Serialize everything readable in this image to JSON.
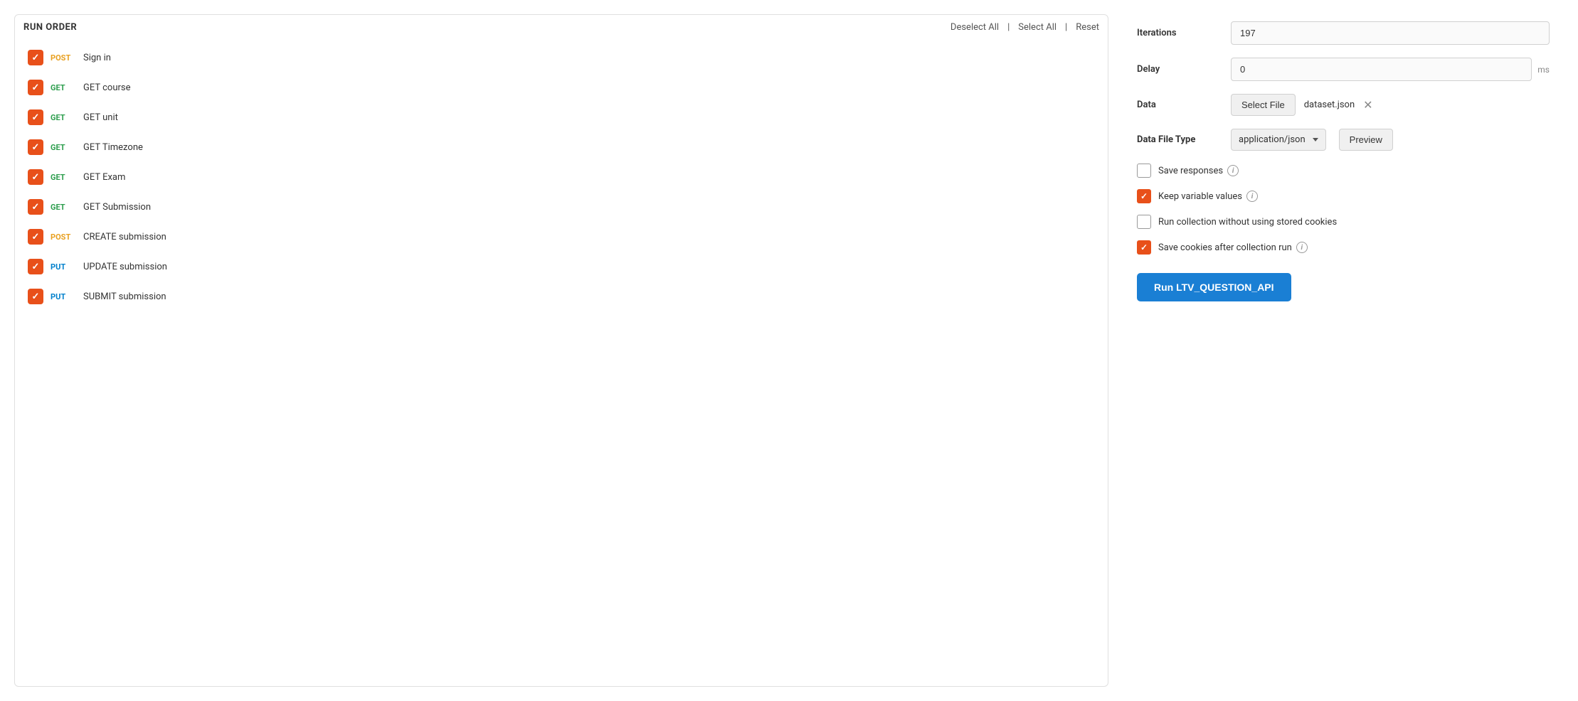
{
  "header": {
    "run_order_title": "RUN ORDER",
    "deselect_all": "Deselect All",
    "select_all": "Select All",
    "reset": "Reset"
  },
  "run_items": [
    {
      "id": 1,
      "method": "POST",
      "method_class": "method-post",
      "name": "Sign in",
      "checked": true
    },
    {
      "id": 2,
      "method": "GET",
      "method_class": "method-get",
      "name": "GET course",
      "checked": true
    },
    {
      "id": 3,
      "method": "GET",
      "method_class": "method-get",
      "name": "GET unit",
      "checked": true
    },
    {
      "id": 4,
      "method": "GET",
      "method_class": "method-get",
      "name": "GET Timezone",
      "checked": true
    },
    {
      "id": 5,
      "method": "GET",
      "method_class": "method-get",
      "name": "GET Exam",
      "checked": true
    },
    {
      "id": 6,
      "method": "GET",
      "method_class": "method-get",
      "name": "GET Submission",
      "checked": true
    },
    {
      "id": 7,
      "method": "POST",
      "method_class": "method-post",
      "name": "CREATE submission",
      "checked": true
    },
    {
      "id": 8,
      "method": "PUT",
      "method_class": "method-put",
      "name": "UPDATE submission",
      "checked": true
    },
    {
      "id": 9,
      "method": "PUT",
      "method_class": "method-put",
      "name": "SUBMIT submission",
      "checked": true
    }
  ],
  "config": {
    "iterations_label": "Iterations",
    "iterations_value": "197",
    "delay_label": "Delay",
    "delay_value": "0",
    "delay_unit": "ms",
    "data_label": "Data",
    "select_file_btn": "Select File",
    "file_name": "dataset.json",
    "data_file_type_label": "Data File Type",
    "data_file_type_value": "application/json",
    "preview_btn": "Preview",
    "save_responses_label": "Save responses",
    "save_responses_checked": false,
    "keep_variable_label": "Keep variable values",
    "keep_variable_checked": true,
    "run_without_cookies_label": "Run collection without using stored cookies",
    "run_without_cookies_checked": false,
    "save_cookies_label": "Save cookies after collection run",
    "save_cookies_checked": true,
    "run_btn": "Run LTV_QUESTION_API"
  }
}
